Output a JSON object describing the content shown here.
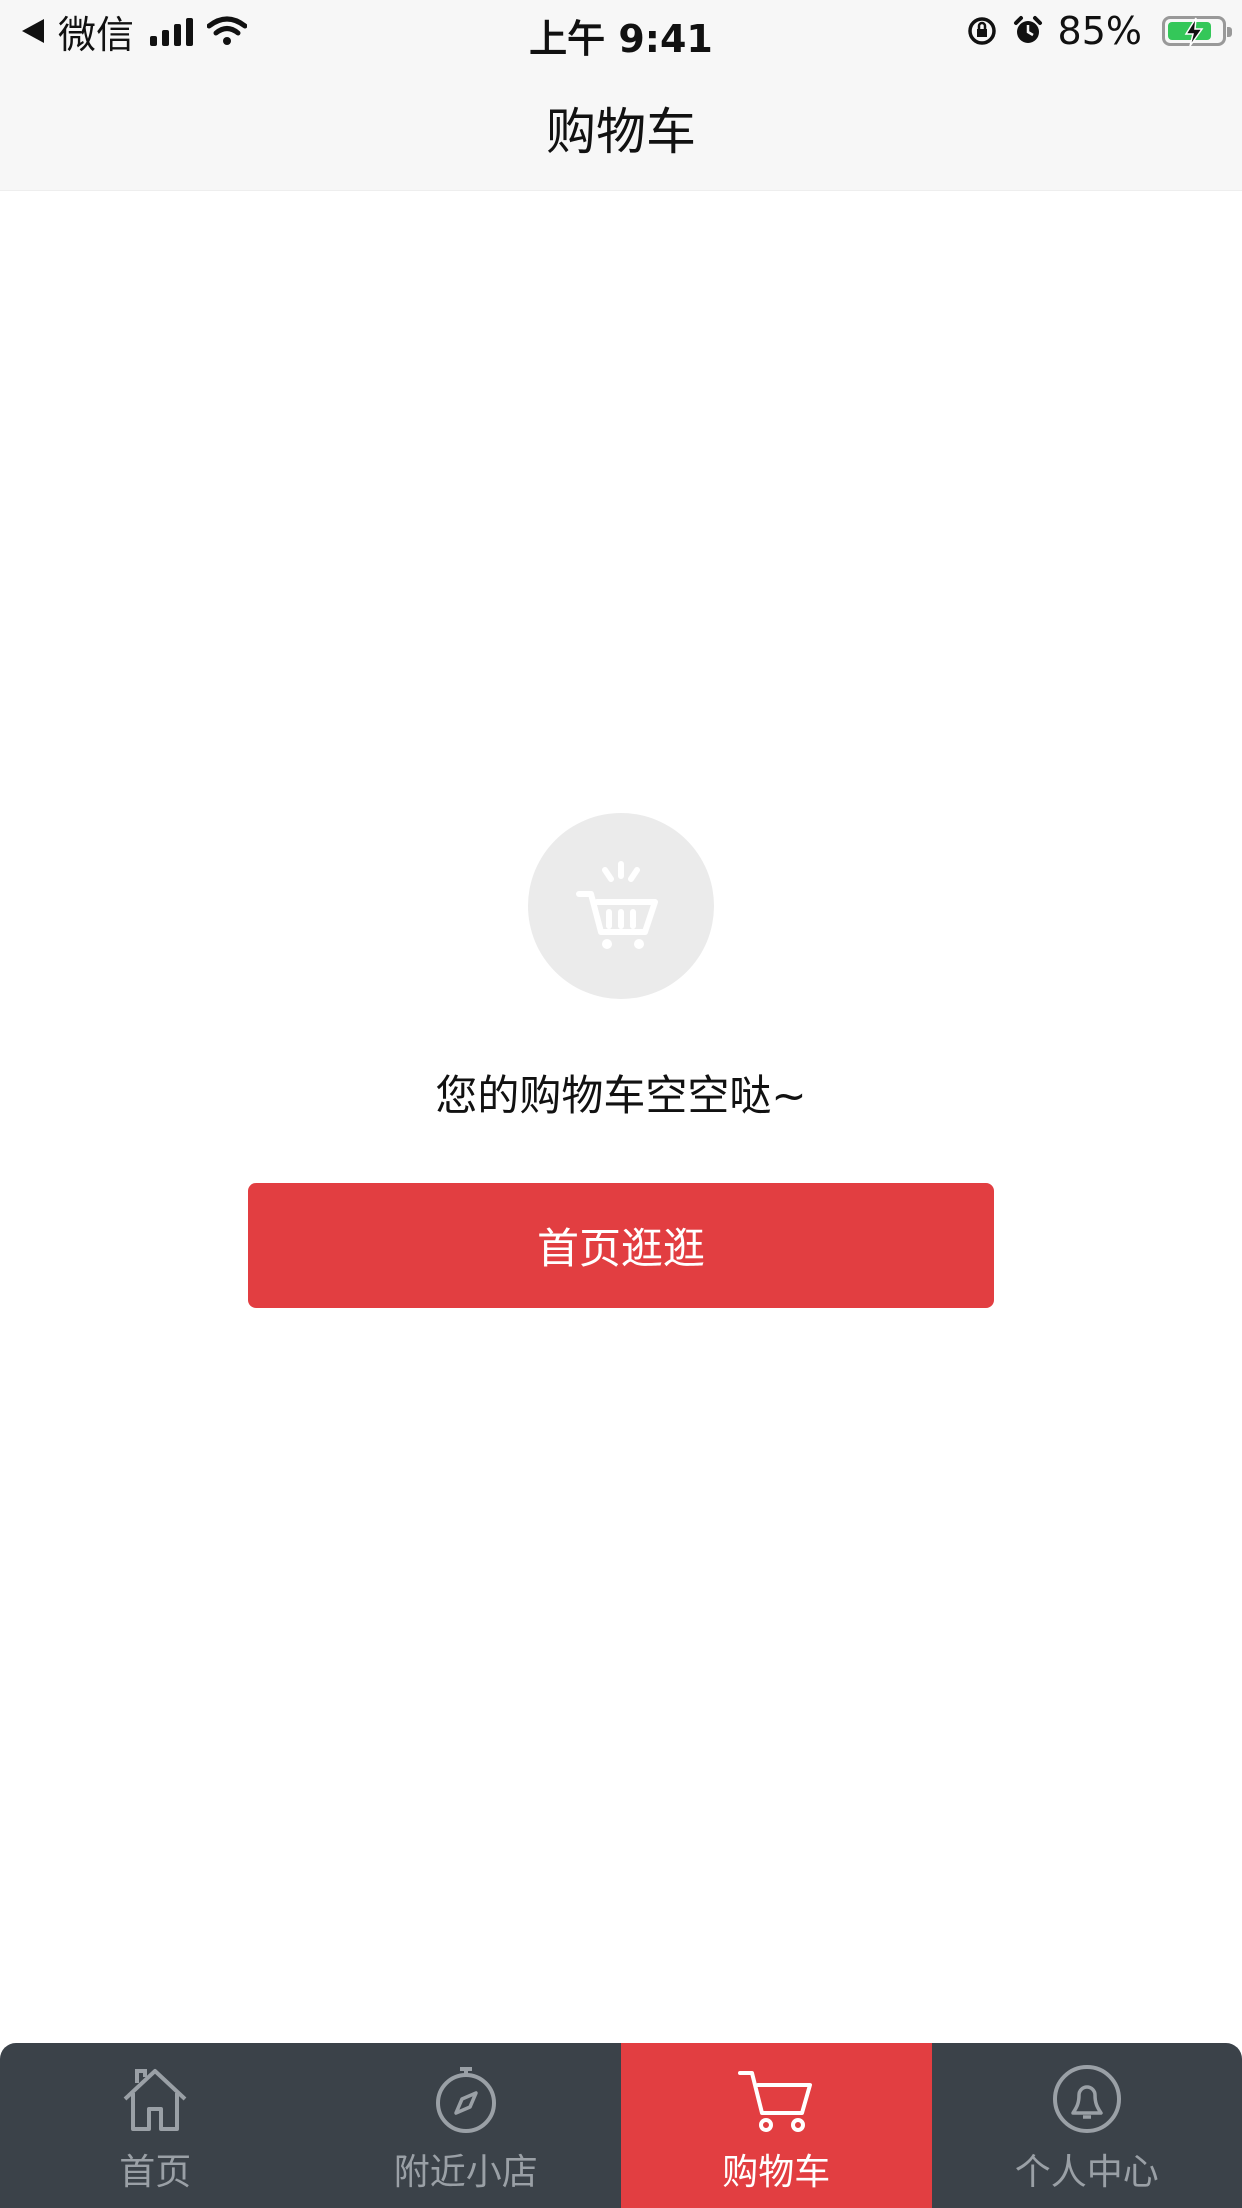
{
  "status_bar": {
    "carrier": "微信",
    "time": "上午 9:41",
    "battery": "85%",
    "battery_level": 0.85
  },
  "nav": {
    "title": "购物车"
  },
  "empty_state": {
    "icon": "cart-icon",
    "message": "您的购物车空空哒~",
    "button_label": "首页逛逛"
  },
  "tabbar": {
    "tabs": [
      {
        "label": "首页",
        "icon": "home-icon",
        "active": false
      },
      {
        "label": "附近小店",
        "icon": "compass-icon",
        "active": false
      },
      {
        "label": "购物车",
        "icon": "cart-icon",
        "active": true
      },
      {
        "label": "个人中心",
        "icon": "user-icon",
        "active": false
      }
    ]
  },
  "colors": {
    "accent": "#e23e41",
    "tabbar_bg": "#3b4249",
    "navbar_bg": "#f7f7f7"
  }
}
